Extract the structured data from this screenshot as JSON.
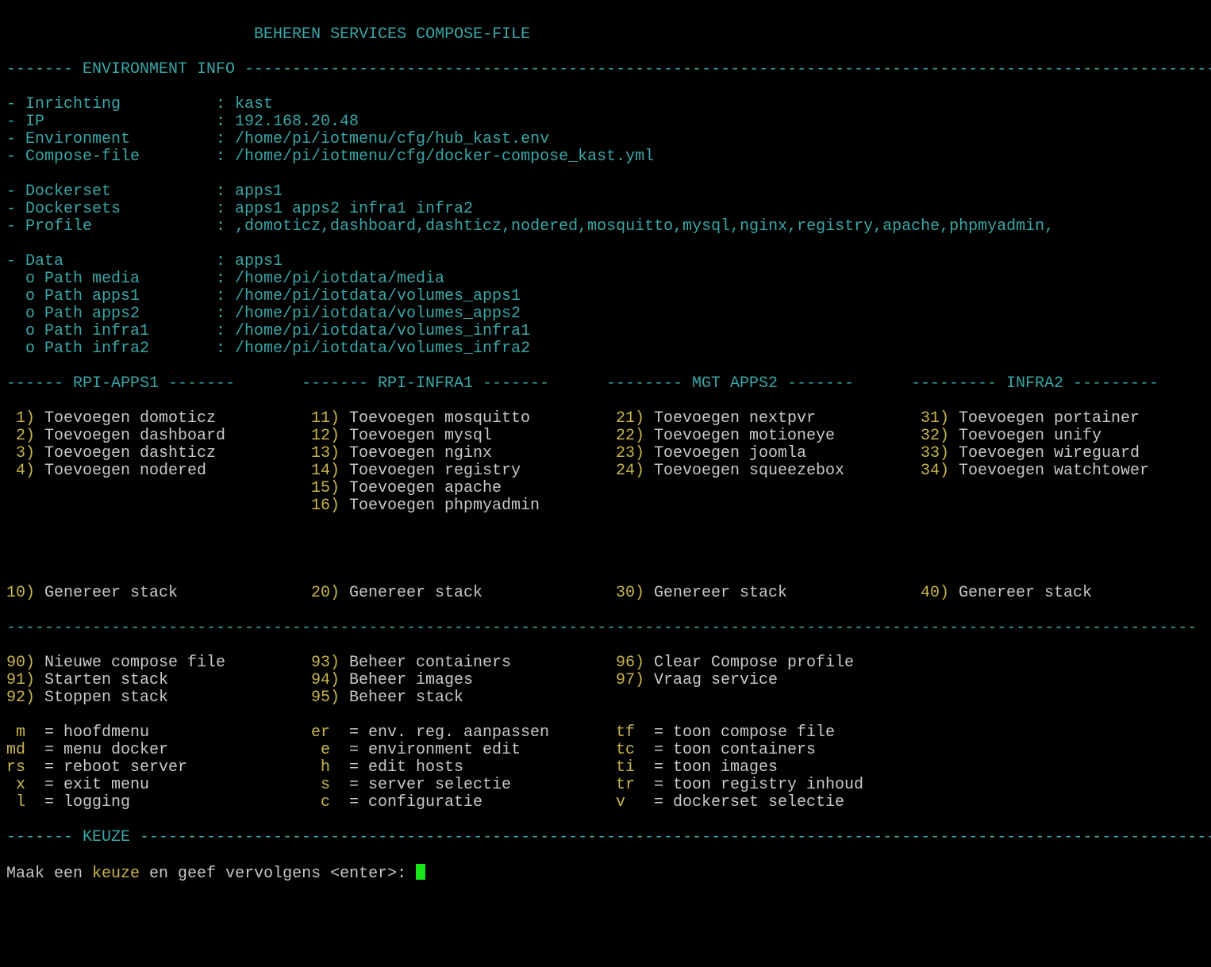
{
  "rule": "-----------------------------------------------------------------------------------------------------------------------------",
  "title": "BEHEREN SERVICES COMPOSE-FILE",
  "env_header": "------- ENVIRONMENT INFO -------------------------------------------------------------------------------------------------------",
  "env": [
    {
      "label": "- Inrichting",
      "value": ": kast"
    },
    {
      "label": "- IP",
      "value": ": 192.168.20.48"
    },
    {
      "label": "- Environment",
      "value": ": /home/pi/iotmenu/cfg/hub_kast.env"
    },
    {
      "label": "- Compose-file",
      "value": ": /home/pi/iotmenu/cfg/docker-compose_kast.yml"
    }
  ],
  "docker": [
    {
      "label": "- Dockerset",
      "value": ": apps1"
    },
    {
      "label": "- Dockersets",
      "value": ": apps1 apps2 infra1 infra2"
    },
    {
      "label": "- Profile",
      "value": ": ,domoticz,dashboard,dashticz,nodered,mosquitto,mysql,nginx,registry,apache,phpmyadmin,"
    }
  ],
  "data": [
    {
      "label": "- Data",
      "value": ": apps1"
    },
    {
      "label": "  o Path media",
      "value": ": /home/pi/iotdata/media"
    },
    {
      "label": "  o Path apps1",
      "value": ": /home/pi/iotdata/volumes_apps1"
    },
    {
      "label": "  o Path apps2",
      "value": ": /home/pi/iotdata/volumes_apps2"
    },
    {
      "label": "  o Path infra1",
      "value": ": /home/pi/iotdata/volumes_infra1"
    },
    {
      "label": "  o Path infra2",
      "value": ": /home/pi/iotdata/volumes_infra2"
    }
  ],
  "group_headers": [
    "------ RPI-APPS1 -------",
    "------- RPI-INFRA1 -------",
    "-------- MGT APPS2 -------",
    "--------- INFRA2 ---------"
  ],
  "menu_rows": [
    [
      {
        "key": " 1)",
        "label": " Toevoegen domoticz"
      },
      {
        "key": "11)",
        "label": " Toevoegen mosquitto"
      },
      {
        "key": "21)",
        "label": " Toevoegen nextpvr"
      },
      {
        "key": "31)",
        "label": " Toevoegen portainer"
      }
    ],
    [
      {
        "key": " 2)",
        "label": " Toevoegen dashboard"
      },
      {
        "key": "12)",
        "label": " Toevoegen mysql"
      },
      {
        "key": "22)",
        "label": " Toevoegen motioneye"
      },
      {
        "key": "32)",
        "label": " Toevoegen unify"
      }
    ],
    [
      {
        "key": " 3)",
        "label": " Toevoegen dashticz"
      },
      {
        "key": "13)",
        "label": " Toevoegen nginx"
      },
      {
        "key": "23)",
        "label": " Toevoegen joomla"
      },
      {
        "key": "33)",
        "label": " Toevoegen wireguard"
      }
    ],
    [
      {
        "key": " 4)",
        "label": " Toevoegen nodered"
      },
      {
        "key": "14)",
        "label": " Toevoegen registry"
      },
      {
        "key": "24)",
        "label": " Toevoegen squeezebox"
      },
      {
        "key": "34)",
        "label": " Toevoegen watchtower"
      }
    ],
    [
      null,
      {
        "key": "15)",
        "label": " Toevoegen apache"
      },
      null,
      null
    ],
    [
      null,
      {
        "key": "16)",
        "label": " Toevoegen phpmyadmin"
      },
      null,
      null
    ]
  ],
  "generate_row": [
    {
      "key": "10)",
      "label": " Genereer stack"
    },
    {
      "key": "20)",
      "label": " Genereer stack"
    },
    {
      "key": "30)",
      "label": " Genereer stack"
    },
    {
      "key": "40)",
      "label": " Genereer stack"
    }
  ],
  "action_rows": [
    [
      {
        "key": "90)",
        "label": " Nieuwe compose file"
      },
      {
        "key": "93)",
        "label": " Beheer containers"
      },
      {
        "key": "96)",
        "label": " Clear Compose profile"
      }
    ],
    [
      {
        "key": "91)",
        "label": " Starten stack"
      },
      {
        "key": "94)",
        "label": " Beheer images"
      },
      {
        "key": "97)",
        "label": " Vraag service"
      }
    ],
    [
      {
        "key": "92)",
        "label": " Stoppen stack"
      },
      {
        "key": "95)",
        "label": " Beheer stack"
      },
      null
    ]
  ],
  "shortcut_rows": [
    [
      {
        "key": " m ",
        "label": " = hoofdmenu"
      },
      {
        "key": "er ",
        "label": " = env. reg. aanpassen"
      },
      {
        "key": "tf ",
        "label": " = toon compose file"
      }
    ],
    [
      {
        "key": "md ",
        "label": " = menu docker"
      },
      {
        "key": " e ",
        "label": " = environment edit"
      },
      {
        "key": "tc ",
        "label": " = toon containers"
      }
    ],
    [
      {
        "key": "rs ",
        "label": " = reboot server"
      },
      {
        "key": " h ",
        "label": " = edit hosts"
      },
      {
        "key": "ti ",
        "label": " = toon images"
      }
    ],
    [
      {
        "key": " x ",
        "label": " = exit menu"
      },
      {
        "key": " s ",
        "label": " = server selectie"
      },
      {
        "key": "tr ",
        "label": " = toon registry inhoud"
      }
    ],
    [
      {
        "key": " l ",
        "label": " = logging"
      },
      {
        "key": " c ",
        "label": " = configuratie"
      },
      {
        "key": "v  ",
        "label": " = dockerset selectie"
      }
    ]
  ],
  "keuze_header": "------- KEUZE ------------------------------------------------------------------------------------------------------------------",
  "prompt": {
    "before": "Maak een ",
    "highlight": "keuze",
    "after": " en geef vervolgens <enter>: "
  }
}
